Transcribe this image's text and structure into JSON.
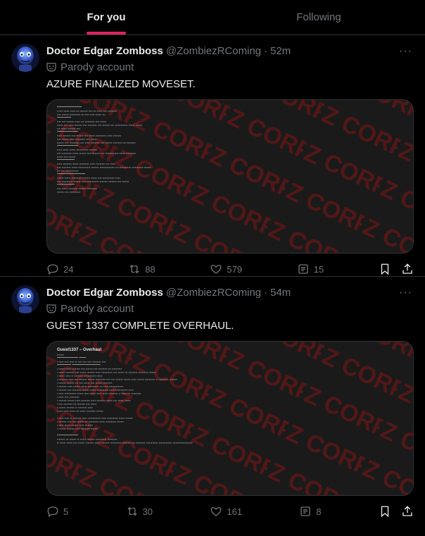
{
  "tabs": [
    {
      "label": "For you",
      "active": true
    },
    {
      "label": "Following",
      "active": false
    }
  ],
  "colors": {
    "accent": "#e0245e",
    "muted": "#71767b",
    "divider": "#2f3336"
  },
  "posts": [
    {
      "author": "Doctor Edgar Zomboss",
      "handle": "@ZombiezRComing",
      "dot": "·",
      "time": "52m",
      "more": "···",
      "parody_label": "Parody account",
      "text": "AZURE FINALIZED MOVESET.",
      "watermark": "Z CORP",
      "replies": "24",
      "reposts": "88",
      "likes": "579",
      "views": "15"
    },
    {
      "author": "Doctor Edgar Zomboss",
      "handle": "@ZombiezRComing",
      "dot": "·",
      "time": "54m",
      "more": "···",
      "parody_label": "Parody account",
      "text": "GUEST 1337 COMPLETE OVERHAUL.",
      "watermark": "Z CORP",
      "media_title": "Guest1337 – Overhaul",
      "replies": "5",
      "reposts": "30",
      "likes": "161",
      "views": "8"
    }
  ]
}
